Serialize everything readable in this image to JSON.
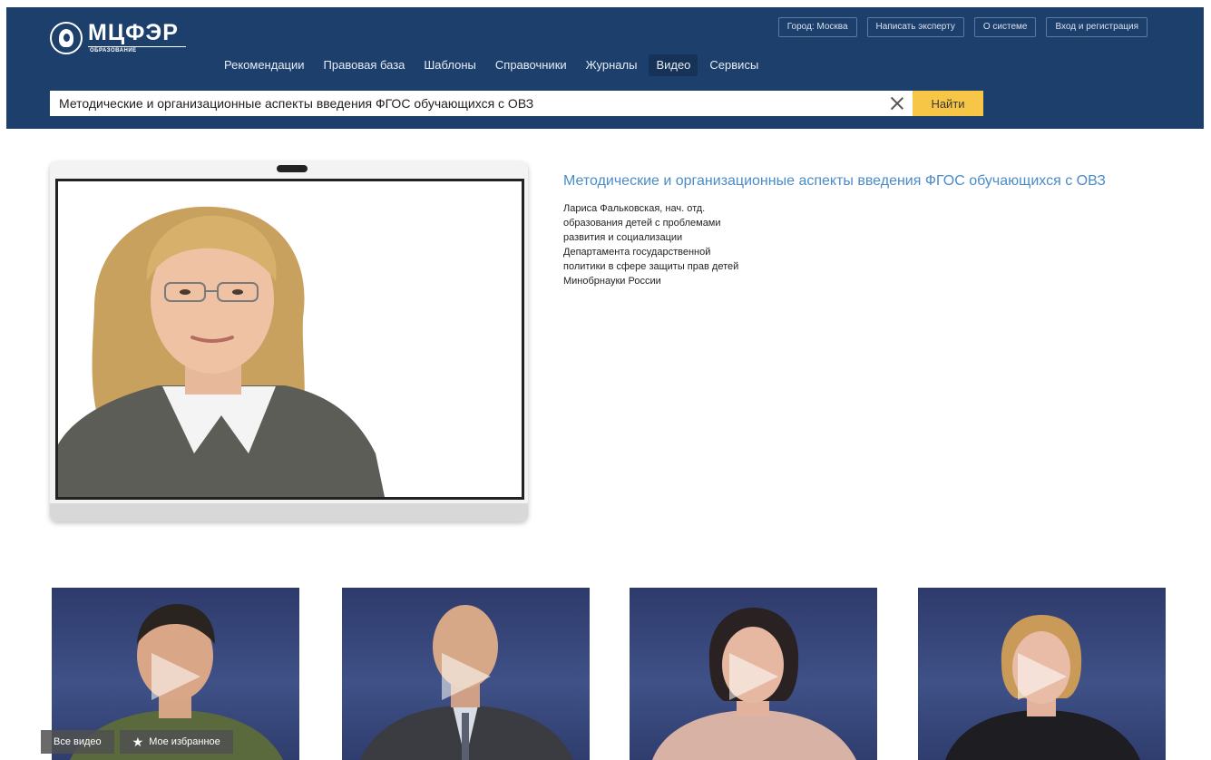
{
  "brand": {
    "name": "МЦФЭР",
    "subtitle": "ОБРАЗОВАНИЕ"
  },
  "top_links": [
    {
      "label": "Город: Москва"
    },
    {
      "label": "Написать эксперту"
    },
    {
      "label": "О системе"
    },
    {
      "label": "Вход и регистрация"
    }
  ],
  "nav": {
    "items": [
      {
        "label": "Рекомендации"
      },
      {
        "label": "Правовая база"
      },
      {
        "label": "Шаблоны"
      },
      {
        "label": "Справочники"
      },
      {
        "label": "Журналы"
      },
      {
        "label": "Видео",
        "active": true
      },
      {
        "label": "Сервисы"
      }
    ]
  },
  "search": {
    "value": "Методические и организационные аспекты введения ФГОС обучающихся с ОВЗ",
    "button_label": "Найти"
  },
  "video": {
    "title": "Методические и организационные аспекты введения ФГОС обучающихся с ОВЗ",
    "description_lines": [
      "Лариса Фальковская, нач. отд.",
      "образования детей с проблемами",
      "развития и социализации",
      "Департамента государственной",
      "политики в сфере защиты прав детей",
      "Минобрнауки России"
    ]
  },
  "thumb_buttons": {
    "all_videos": "Все видео",
    "favorites": "Мое избранное"
  },
  "colors": {
    "header_bg": "#1d3f6c",
    "accent_button": "#f8c646",
    "title_link": "#4b8bc8"
  }
}
